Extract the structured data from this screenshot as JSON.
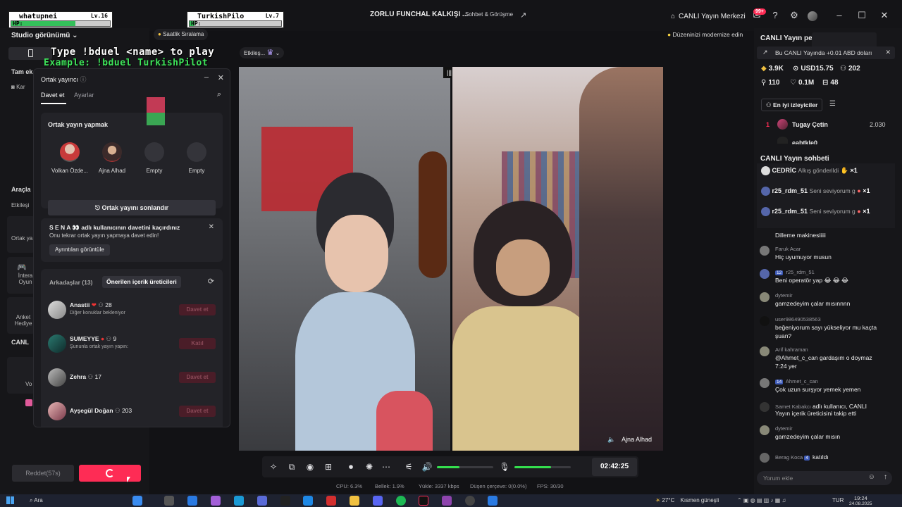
{
  "window": {
    "title": "ZORLU FUNCHAL KALKIŞI ...",
    "subtitle": "Sohbet & Görüşme",
    "live_center": "CANLI Yayın Merkezi",
    "notif_badge": "99+"
  },
  "game": {
    "player1": {
      "name": "whatupnei",
      "level": "Lv.16",
      "hp_label": "HP:",
      "hp_fraction": 0.65
    },
    "player2": {
      "name": "TurkishPilo",
      "level": "Lv.7",
      "hp_label": "HP:",
      "hp_fraction": 0.05
    },
    "instruction": "Type !bduel <name> to play",
    "example": "Example: !bduel TurkishPilot"
  },
  "left": {
    "studio_view": "Studio görünümü",
    "hourly_rank": "Saatlik Sıralama",
    "tam_label": "Tam ek",
    "kar_label": "Kar",
    "tools_label": "Araçla",
    "etkiles_label": "Etkileşi",
    "ortak_label": "Ortak ya",
    "intera_label": "İntera Oyun",
    "anket_label": "Anket Hediye",
    "canli_label": "CANL",
    "vo_label": "Vo",
    "interaction_chip": "Etkileş...",
    "reject_label": "Reddet(57s)"
  },
  "panel": {
    "title": "Ortak yayıncı",
    "tab_invite": "Davet et",
    "tab_settings": "Ayarlar",
    "cohost_heading": "Ortak yayın yapmak",
    "slots": [
      {
        "label": "Volkan Özde..."
      },
      {
        "label": "Ajna Alhad"
      },
      {
        "label": "Empty"
      },
      {
        "label": "Empty"
      }
    ],
    "end_button": "Ortak yayını sonlandır",
    "missed_title": "S E N A 👀 adlı kullanıcının davetini kaçırdınız",
    "missed_sub": "Onu tekrar ortak yayın yapmaya davet edin!",
    "details_button": "Ayrıntıları görüntüle",
    "tab_friends": "Arkadaşlar (13)",
    "tab_suggested": "Önerilen içerik üreticileri",
    "friends": [
      {
        "name": "Anastii",
        "count": "28",
        "sub": "Diğer konuklar bekleniyor",
        "action": "Davet et"
      },
      {
        "name": "SUMEYYE",
        "count": "9",
        "sub": "Şununla ortak yayın yapın:",
        "action": "Katıl"
      },
      {
        "name": "Zehra",
        "count": "17",
        "sub": "",
        "action": "Davet et"
      },
      {
        "name": "Ayşegül Doğan",
        "count": "203",
        "sub": "",
        "action": "Davet et"
      }
    ]
  },
  "video": {
    "right_name": "Ajna Alhad",
    "timer": "02:42:25",
    "stats": {
      "cpu": "CPU: 6.3%",
      "memory": "Bellek: 1.9%",
      "upload": "Yükle: 3337 kbps",
      "dropped": "Düşen çerçeve: 0(0.0%)",
      "fps": "FPS: 30/30"
    },
    "volume_fraction": 0.4,
    "mic_fraction": 0.65
  },
  "right": {
    "tip": "Düzeninizi modernize edin",
    "canli_heading": "CANLI Yayın pe",
    "earn_text": "Bu CANLI Yayında +0.01 ABD doları",
    "stats": {
      "diamonds": "3.9K",
      "usd": "USD15.75",
      "viewers": "202",
      "shares": "110",
      "likes": "0.1M",
      "gifts": "48"
    },
    "top_viewers_button": "En iyi izleyiciler",
    "top_viewers": [
      {
        "rank": "1",
        "name": "Tugay Çetin",
        "score": "2.030"
      },
      {
        "rank": "",
        "name": "eabtkle0",
        "score": ""
      }
    ],
    "chat_heading": "CANLI Yayın sohbeti",
    "pinned": [
      {
        "name": "CEDRİC",
        "text": "Alkış gönderildi",
        "mult": "×1"
      },
      {
        "name": "r25_rdm_51",
        "text": "Seni seviyorum g",
        "mult": "×1"
      },
      {
        "name": "r25_rdm_51",
        "text": "Seni seviyorum g",
        "mult": "×1"
      }
    ],
    "chat": [
      {
        "user": "",
        "level": "",
        "msg": "Dilleme makinesiiiii"
      },
      {
        "user": "Faruk Acar",
        "level": "",
        "msg": "Hiç uyumuyor musun"
      },
      {
        "user": "r25_rdm_51",
        "level": "12",
        "msg": "Beni operatör yap 😂 😂 😂"
      },
      {
        "user": "dytemir",
        "level": "",
        "msg": "gamzedeyim çalar mısınnnn"
      },
      {
        "user": "user986490538563",
        "level": "",
        "msg": "beğeniyorum sayı yükseliyor mu kaçta"
      },
      {
        "user": "",
        "level": "",
        "msg": "şuan?"
      },
      {
        "user": "Arif kahraman",
        "level": "",
        "msg": "@Ahmet_c_can gardaşım o doymaz"
      },
      {
        "user": "",
        "level": "",
        "msg": "7:24 yer"
      },
      {
        "user": "Ahmet_c_can",
        "level": "14",
        "msg": "Çok uzun surşyor yemek yemen"
      },
      {
        "user": "Samet Kabakcı",
        "level": "",
        "msg": "adlı kullanıcı, CANLI"
      },
      {
        "user": "",
        "level": "",
        "msg": "Yayın içerik üreticisini takip etti"
      },
      {
        "user": "dytemir",
        "level": "",
        "msg": "gamzedeyim çalar mısın"
      },
      {
        "user": "Berag Koca",
        "level": "4",
        "msg": "katıldı"
      }
    ],
    "comment_placeholder": "Yorum ekle"
  },
  "taskbar": {
    "search": "Ara",
    "weather_temp": "27°C",
    "weather_desc": "Kısmen güneşli",
    "lang": "TUR",
    "time": "19:24",
    "date": "24.08.2025"
  },
  "colors": {
    "accent": "#fe2c55",
    "slider_green": "#34e04e",
    "hp_green": "#34c05a"
  }
}
